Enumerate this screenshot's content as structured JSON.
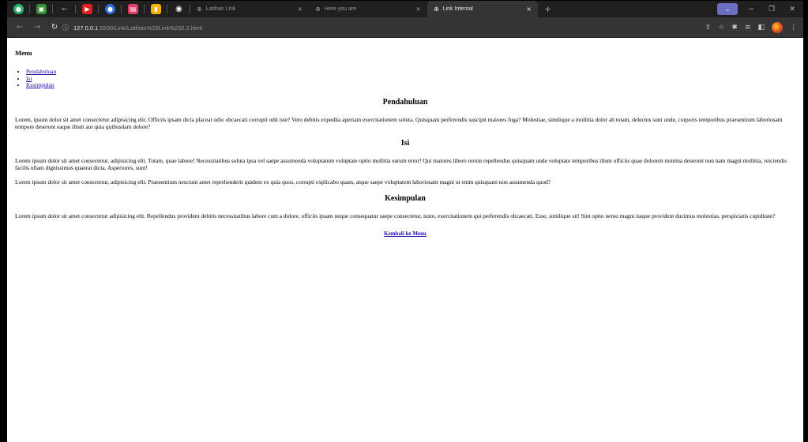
{
  "browser": {
    "tabs": [
      {
        "label": "Latihan Link",
        "active": false
      },
      {
        "label": "Here you are",
        "active": false
      },
      {
        "label": "Link Internal",
        "active": true
      }
    ],
    "close_symbol": "×",
    "new_tab_symbol": "+",
    "address": {
      "host": "127.0.0.1",
      "rest": ":5500/Link/Latihan%20Link%202.2.html"
    },
    "window_controls": {
      "dropdown": "⌄",
      "minimize": "−",
      "restore": "❐",
      "close": "✕"
    },
    "icons": [
      "back-arrow-icon",
      "forward-arrow-icon",
      "reload-icon",
      "info-icon",
      "share-icon",
      "star-icon",
      "extensions-icon",
      "reading-list-icon",
      "side-panel-icon",
      "profile-icon",
      "menu-dots-icon"
    ],
    "colors": {
      "tabbar": "#1f1f1f",
      "toolbar": "#353535",
      "active_tab": "#353535",
      "dropdown": "#6a6fc0"
    }
  },
  "page": {
    "menu_title": "Menu",
    "menu_items": [
      "Pendahuluan",
      "Isi",
      "Kesimpulan"
    ],
    "sections": [
      {
        "heading": "Pendahuluan",
        "paragraphs": [
          "Lorem, ipsum dolor sit amet consectetur adipisicing elit. Officiis ipsam dicta placeat odio obcaecati corrupti odit iste? Vero debitis expedita aperiam exercitationem soluta. Quisquam perferendis suscipit maiores fuga? Molestiae, similique a mollitia dolor ab totam, delectus sunt unde, corporis temporibus praesentium laboriosam tempore deserunt eaque illum aut quia quibusdam dolore?"
        ]
      },
      {
        "heading": "Isi",
        "paragraphs": [
          "Lorem ipsum dolor sit amet consectetur, adipisicing elit. Totam, quae labore! Necessitatibus soluta ipsa vel saepe assumenda voluptatum voluptate optio mollitia earum error! Qui maiores libero rerum repellendus quisquam unde voluptate temporibus illum officiis quae dolorem minima deserunt non nam magni mollitia, reiciendis facilis ullam dignissimos quaerat dicta. Asperiores, sunt!",
          "Lorem ipsum dolor sit amet consectetur, adipisicing elit. Praesentium nesciunt amet reprehenderit quidem ex quia quos, corrupti explicabo quam, atque saepe voluptatem laboriosam magni ut enim quisquam non assumenda quod?"
        ]
      },
      {
        "heading": "Kesimpulan",
        "paragraphs": [
          "Lorem ipsum dolor sit amet consectetur adipisicing elit. Repellendus provident debitis necessitatibus labore cum a dolore, officiis ipsam neque consequatur saepe consectetur, iusto, exercitationem qui perferendis obcaecati. Esse, similique sit! Sint optio nemo magni itaque provident ducimus molestias, perspiciatis cupiditate?"
        ]
      }
    ],
    "back_link": "Kembali ke Menu"
  }
}
